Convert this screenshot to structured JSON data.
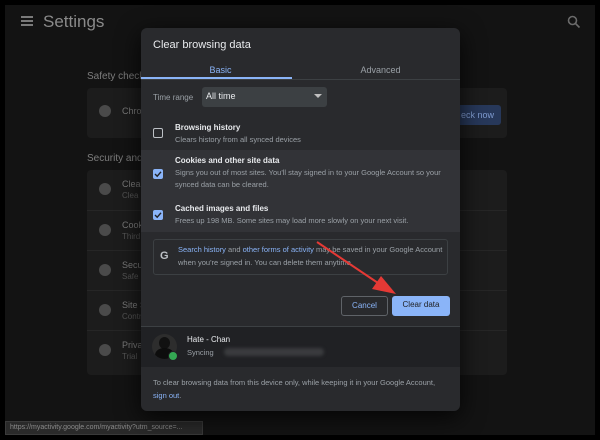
{
  "background": {
    "settings_title": "Settings",
    "safety_check_title": "Safety check",
    "safety_row_label": "Chro",
    "check_now_label": "eck now",
    "privacy_section_title": "Security and",
    "rows": [
      {
        "t1": "Clear",
        "t2": "Clea"
      },
      {
        "t1": "Cooki",
        "t2": "Third"
      },
      {
        "t1": "Secu",
        "t2": "Safe"
      },
      {
        "t1": "Site S",
        "t2": "Contr"
      },
      {
        "t1": "Priva",
        "t2": "Trial"
      }
    ],
    "status_url": "https://myactivity.google.com/myactivity?utm_source=..."
  },
  "dialog": {
    "title": "Clear browsing data",
    "tabs": [
      {
        "label": "Basic",
        "active": true
      },
      {
        "label": "Advanced",
        "active": false
      }
    ],
    "time_range": {
      "label": "Time range",
      "value": "All time"
    },
    "options": [
      {
        "title": "Browsing history",
        "desc": "Clears history from all synced devices",
        "checked": false
      },
      {
        "title": "Cookies and other site data",
        "desc": "Signs you out of most sites. You'll stay signed in to your Google Account so your synced data can be cleared.",
        "checked": true
      },
      {
        "title": "Cached images and files",
        "desc": "Frees up 198 MB. Some sites may load more slowly on your next visit.",
        "checked": true
      }
    ],
    "info": {
      "link1": "Search history",
      "mid1": " and ",
      "link2": "other forms of activity",
      "rest": " may be saved in your Google Account when you're signed in. You can delete them anytime."
    },
    "buttons": {
      "cancel": "Cancel",
      "clear": "Clear data"
    },
    "account": {
      "name": "Hate - Chan",
      "sync_prefix": "Syncing"
    },
    "footer": {
      "text": "To clear browsing data from this device only, while keeping it in your Google Account, ",
      "link": "sign out",
      "end": "."
    }
  },
  "colors": {
    "accent": "#8ab4f8",
    "dialog_bg": "#292a2d",
    "arrow": "#e53935",
    "sync_badge": "#34a853"
  }
}
